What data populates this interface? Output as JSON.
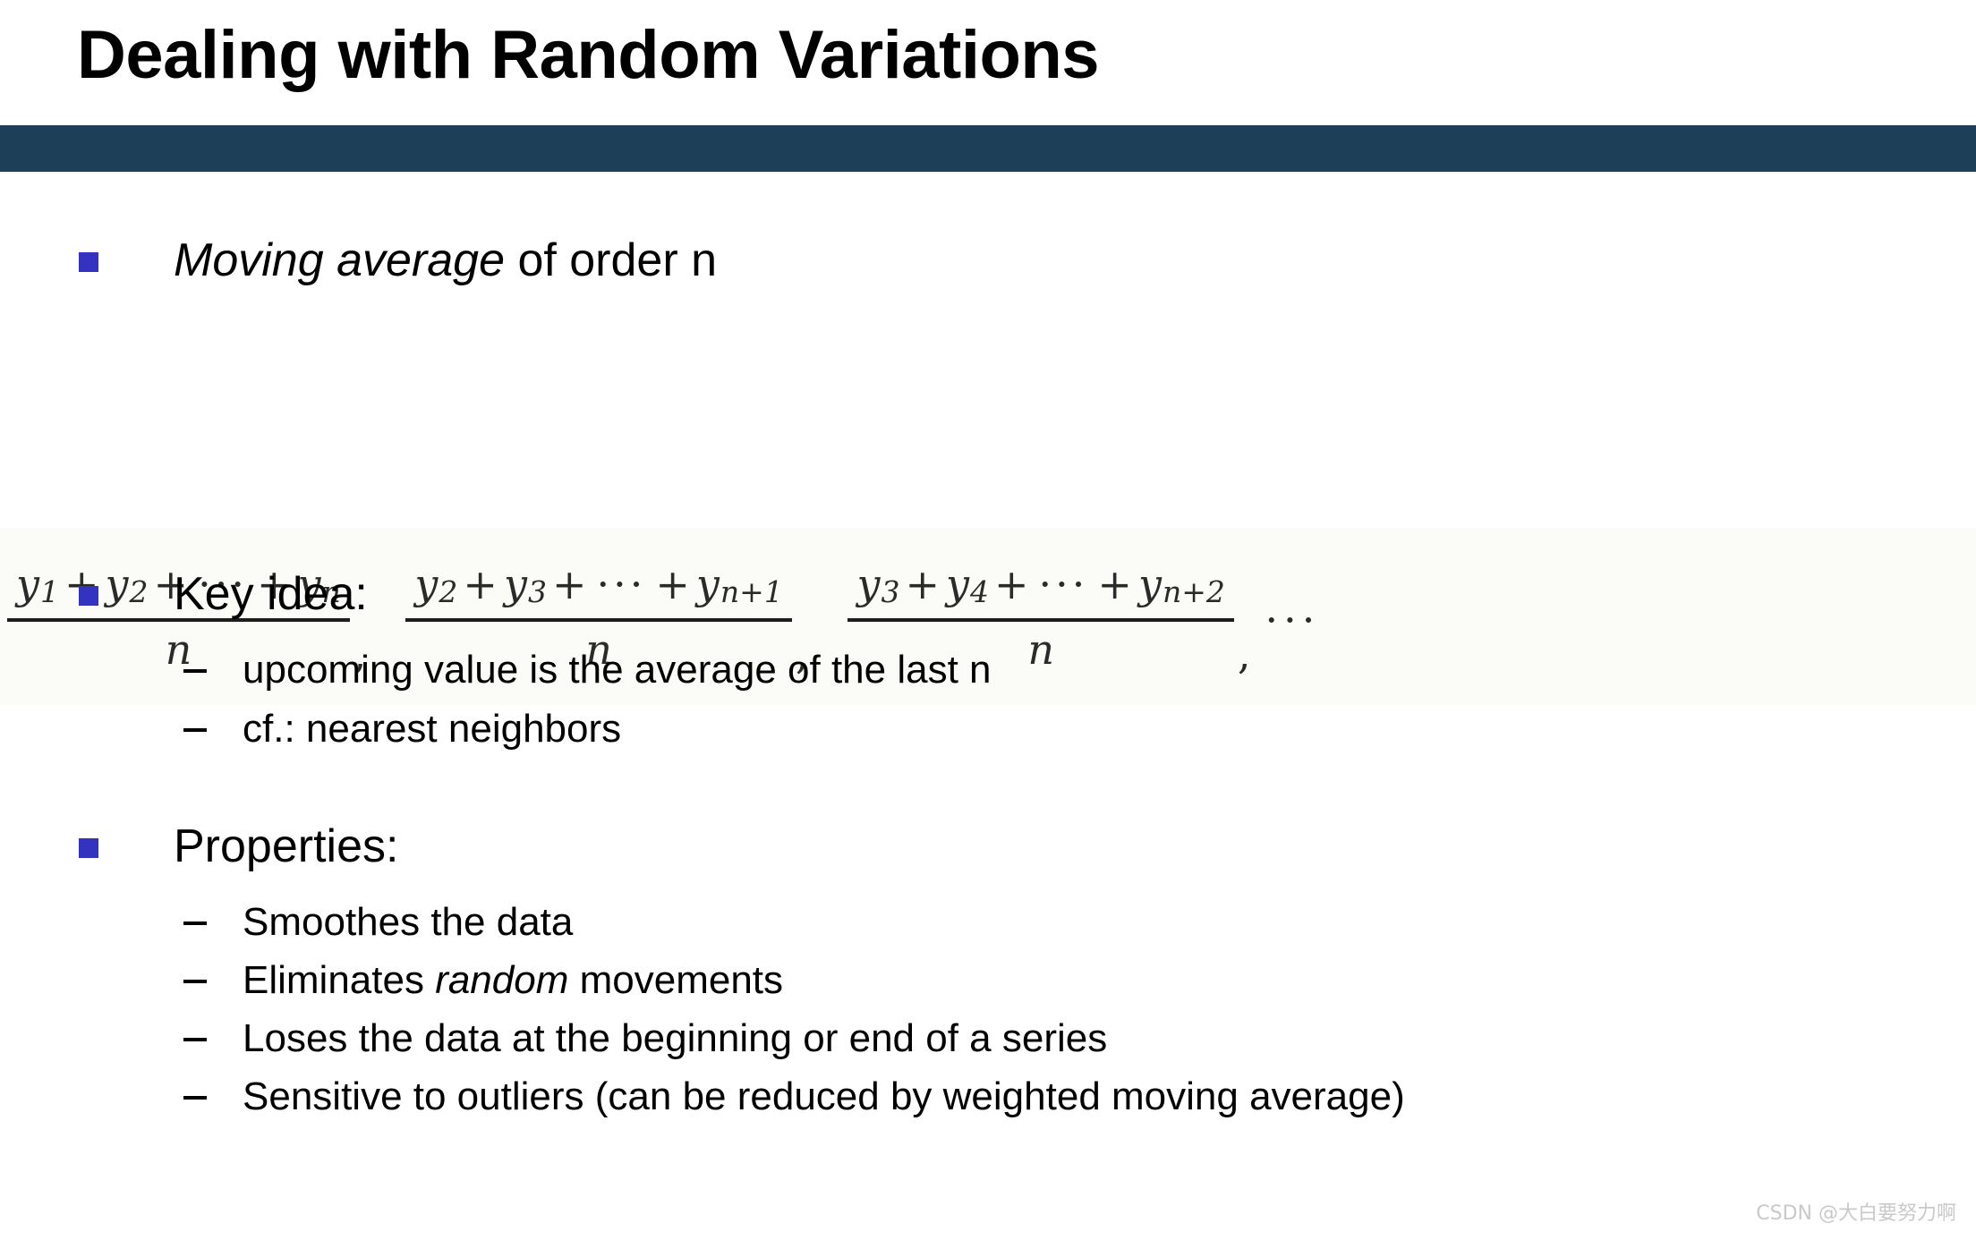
{
  "slide": {
    "title": "Dealing with Random Variations",
    "accent_bar_color": "#1d4058",
    "bullet_marker_color": "#3333bf",
    "background_color": "#ffffff",
    "formula_band_color": "#fbfcf7"
  },
  "bullets": [
    {
      "level": 1,
      "marker": "square",
      "text_italic": "Moving average",
      "text_plain": " of order n"
    },
    {
      "level": 1,
      "marker": "square",
      "text": "Key idea:"
    },
    {
      "level": 2,
      "marker": "dash",
      "text": "upcoming value is the average of the last n"
    },
    {
      "level": 2,
      "marker": "dash",
      "text": "cf.: nearest neighbors"
    },
    {
      "level": 1,
      "marker": "square",
      "text": "Properties:"
    },
    {
      "level": 2,
      "marker": "dash",
      "text": "Smoothes the data"
    },
    {
      "level": 2,
      "marker": "dash",
      "text_before": "Eliminates ",
      "text_italic": "random",
      "text_after": " movements"
    },
    {
      "level": 2,
      "marker": "dash",
      "text": "Loses the data at the beginning or end of a series"
    },
    {
      "level": 2,
      "marker": "dash",
      "text": "Sensitive to outliers (can be reduced by weighted moving average)"
    }
  ],
  "formula": {
    "description": "Moving average of order n: successive windowed means",
    "fractions": [
      {
        "numerator_terms": [
          "y",
          "1",
          "y",
          "2",
          "y",
          "n"
        ],
        "numerator_text": "y1 + y2 + ··· + yn",
        "denominator": "n",
        "separator": ","
      },
      {
        "numerator_terms": [
          "y",
          "2",
          "y",
          "3",
          "y",
          "n+1"
        ],
        "numerator_text": "y2 + y3 + ··· + yn+1",
        "denominator": "n",
        "separator": ","
      },
      {
        "numerator_terms": [
          "y",
          "3",
          "y",
          "4",
          "y",
          "n+2"
        ],
        "numerator_text": "y3 + y4 + ··· + yn+2",
        "denominator": "n",
        "separator": ","
      }
    ],
    "trailing": "···",
    "plus_sign": "+",
    "ellipsis": "···",
    "base_symbol": "y",
    "denominator_symbol": "n",
    "subscripts": {
      "f1": [
        "1",
        "2",
        "n"
      ],
      "f2": [
        "2",
        "3",
        "n+1"
      ],
      "f3": [
        "3",
        "4",
        "n+2"
      ]
    }
  },
  "watermark": {
    "text": "CSDN @大白要努力啊"
  }
}
